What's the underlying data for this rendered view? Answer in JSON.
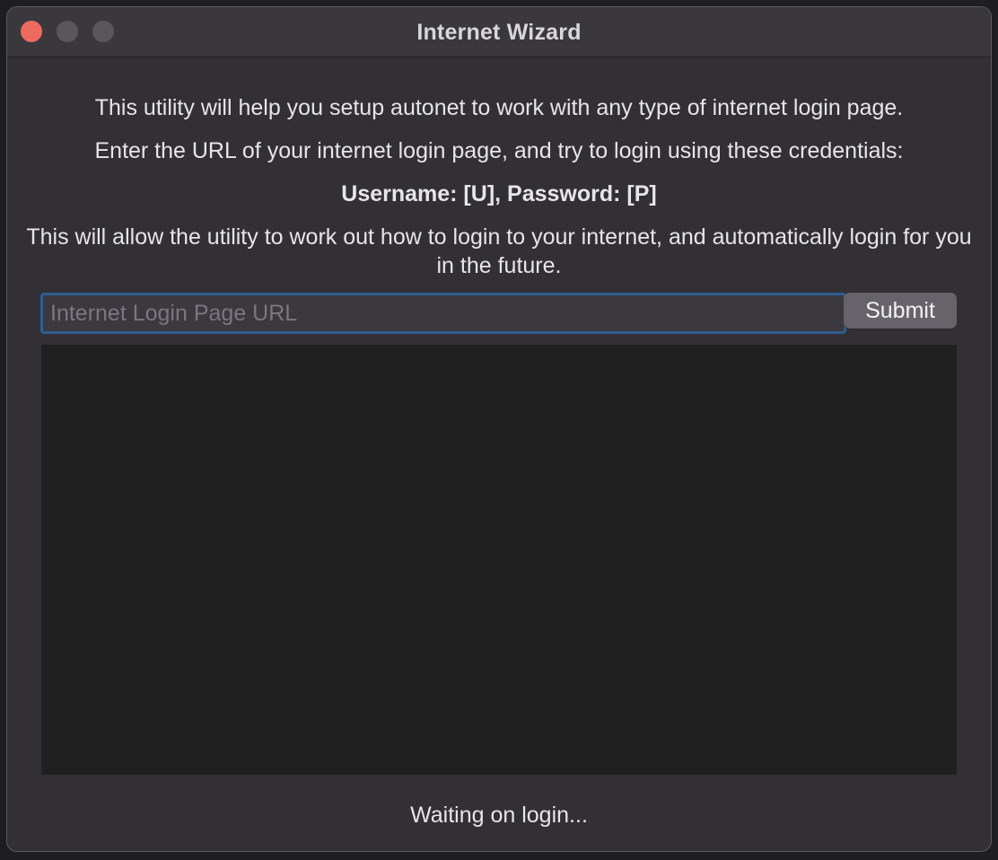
{
  "window": {
    "title": "Internet Wizard"
  },
  "instructions": {
    "line1": "This utility will help you setup autonet to work with any type of internet login page.",
    "line2": "Enter the URL of your internet login page, and try to login using these credentials:",
    "credentials": "Username: [U], Password: [P]",
    "line4": "This will allow the utility to work out how to login to your internet, and automatically login for you in the future."
  },
  "form": {
    "url_value": "",
    "url_placeholder": "Internet Login Page URL",
    "submit_label": "Submit"
  },
  "status": {
    "text": "Waiting on login..."
  },
  "colors": {
    "window_bg": "#323035",
    "titlebar_bg": "#3a383d",
    "close_light": "#ec6a5e",
    "focus_ring": "#2f5d92",
    "output_bg": "#202021"
  }
}
